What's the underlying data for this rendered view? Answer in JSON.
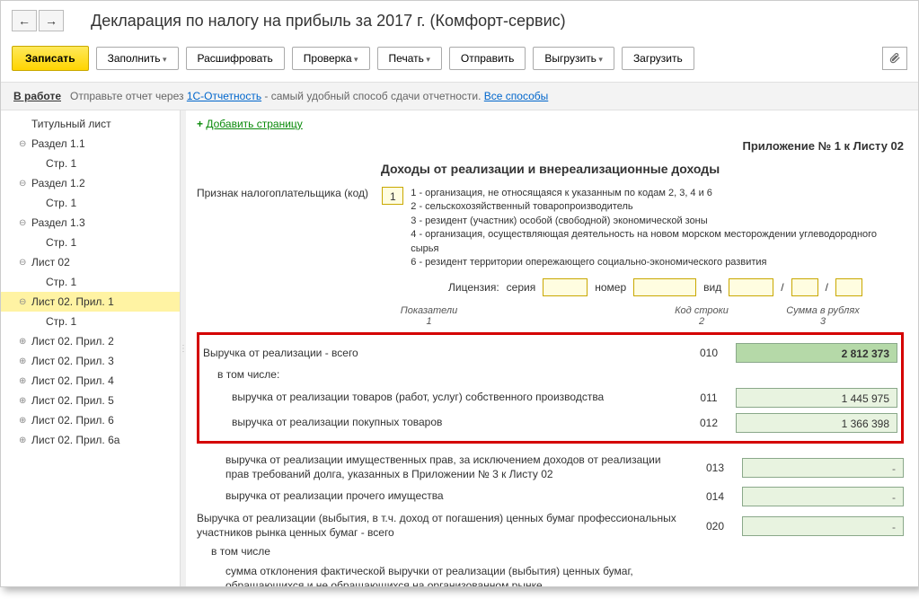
{
  "title": "Декларация по налогу на прибыль за 2017 г. (Комфорт-сервис)",
  "toolbar": {
    "save": "Записать",
    "fill": "Заполнить",
    "explain": "Расшифровать",
    "check": "Проверка",
    "print": "Печать",
    "send": "Отправить",
    "export": "Выгрузить",
    "import": "Загрузить"
  },
  "status": {
    "active": "В работе",
    "msg1": "Отправьте отчет через ",
    "link1": "1С-Отчетность",
    "msg2": " - самый удобный способ сдачи отчетности. ",
    "link2": "Все способы"
  },
  "tree": [
    {
      "label": "Титульный лист",
      "level": 0,
      "toggle": ""
    },
    {
      "label": "Раздел 1.1",
      "level": 0,
      "toggle": "⊖"
    },
    {
      "label": "Стр. 1",
      "level": 1,
      "toggle": ""
    },
    {
      "label": "Раздел 1.2",
      "level": 0,
      "toggle": "⊖"
    },
    {
      "label": "Стр. 1",
      "level": 1,
      "toggle": ""
    },
    {
      "label": "Раздел 1.3",
      "level": 0,
      "toggle": "⊖"
    },
    {
      "label": "Стр. 1",
      "level": 1,
      "toggle": ""
    },
    {
      "label": "Лист 02",
      "level": 0,
      "toggle": "⊖"
    },
    {
      "label": "Стр. 1",
      "level": 1,
      "toggle": ""
    },
    {
      "label": "Лист 02. Прил. 1",
      "level": 0,
      "toggle": "⊖",
      "selected": true
    },
    {
      "label": "Стр. 1",
      "level": 1,
      "toggle": ""
    },
    {
      "label": "Лист 02. Прил. 2",
      "level": 0,
      "toggle": "⊕"
    },
    {
      "label": "Лист 02. Прил. 3",
      "level": 0,
      "toggle": "⊕"
    },
    {
      "label": "Лист 02. Прил. 4",
      "level": 0,
      "toggle": "⊕"
    },
    {
      "label": "Лист 02. Прил. 5",
      "level": 0,
      "toggle": "⊕"
    },
    {
      "label": "Лист 02. Прил. 6",
      "level": 0,
      "toggle": "⊕"
    },
    {
      "label": "Лист 02. Прил. 6а",
      "level": 0,
      "toggle": "⊕"
    }
  ],
  "content": {
    "add_page": "Добавить страницу",
    "appendix": "Приложение № 1 к Листу 02",
    "section_title": "Доходы от реализации и внереализационные доходы",
    "taxpayer_label": "Признак налогоплательщика (код)",
    "taxpayer_code": "1",
    "code_desc": [
      "1 - организация, не относящаяся к указанным по кодам 2, 3, 4 и 6",
      "2 - сельскохозяйственный товаропроизводитель",
      "3 - резидент (участник) особой (свободной) экономической зоны",
      "4 - организация, осуществляющая деятельность на новом морском месторождении углеводородного сырья",
      "6 - резидент территории опережающего социально-экономического развития"
    ],
    "license": {
      "label": "Лицензия:",
      "seria": "серия",
      "nomer": "номер",
      "vid": "вид",
      "slash": "/"
    },
    "headers": {
      "h1": "Показатели",
      "h1n": "1",
      "h2": "Код строки",
      "h2n": "2",
      "h3": "Сумма в рублях",
      "h3n": "3"
    },
    "rows_highlighted": [
      {
        "label": "Выручка от реализации - всего",
        "code": "010",
        "value": "2 812 373",
        "total": true,
        "indent": 0
      },
      {
        "label": "в том числе:",
        "code": "",
        "value": null,
        "indent": 1
      },
      {
        "label": "выручка от реализации товаров (работ, услуг) собственного производства",
        "code": "011",
        "value": "1 445 975",
        "indent": 2
      },
      {
        "label": "выручка от реализации покупных товаров",
        "code": "012",
        "value": "1 366 398",
        "indent": 2
      }
    ],
    "rows_after": [
      {
        "label": "выручка от реализации имущественных прав, за исключением доходов от реализации прав требований долга, указанных в Приложении № 3 к Листу 02",
        "code": "013",
        "value": "",
        "indent": 2
      },
      {
        "label": "выручка от реализации прочего имущества",
        "code": "014",
        "value": "",
        "indent": 2
      },
      {
        "label": "Выручка от реализации (выбытия, в т.ч. доход от погашения) ценных бумаг профессиональных участников рынка ценных бумаг - всего",
        "code": "020",
        "value": "",
        "indent": 0
      },
      {
        "label": "в том числе",
        "code": "",
        "value": null,
        "indent": 1
      },
      {
        "label": "сумма отклонения фактической выручки от реализации (выбытия) ценных бумаг, обращающихся и не обращающихся на организованном рынке",
        "code": "",
        "value": null,
        "indent": 2
      }
    ]
  }
}
